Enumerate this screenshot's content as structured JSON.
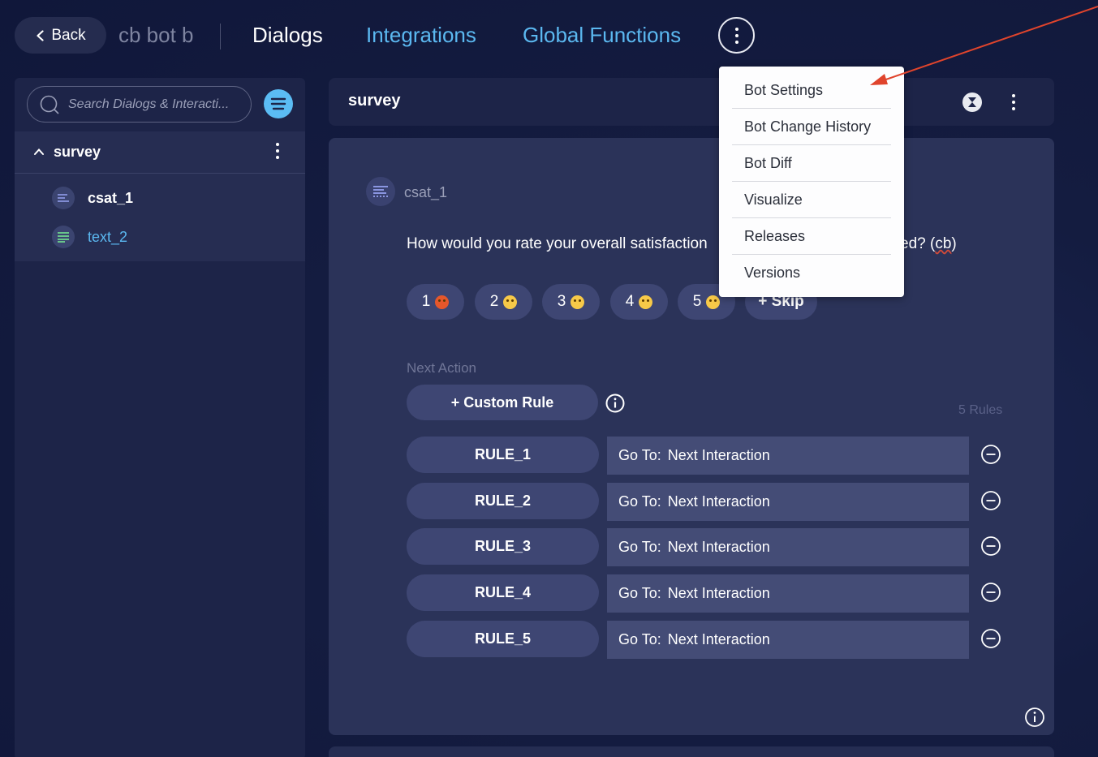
{
  "topbar": {
    "back_label": "Back",
    "bot_name": "cb bot b",
    "nav": {
      "dialogs": "Dialogs",
      "integrations": "Integrations",
      "global_functions": "Global Functions"
    }
  },
  "sidebar": {
    "search_placeholder": "Search Dialogs & Interacti...",
    "dialog_title": "survey",
    "items": [
      {
        "label": "csat_1",
        "icon": "list-icon"
      },
      {
        "label": "text_2",
        "icon": "text-icon"
      }
    ]
  },
  "header": {
    "title": "survey"
  },
  "node": {
    "name": "csat_1",
    "question_part1": "How would you rate your overall satisfaction",
    "question_part2_prefix": "ed? (",
    "question_part2_cb": "cb",
    "question_part2_suffix": ")",
    "choices": [
      {
        "label": "1",
        "emoji": "angry-face-icon"
      },
      {
        "label": "2",
        "emoji": "frowning-face-icon"
      },
      {
        "label": "3",
        "emoji": "neutral-face-icon"
      },
      {
        "label": "4",
        "emoji": "slightly-smiling-face-icon"
      },
      {
        "label": "5",
        "emoji": "grinning-face-icon"
      }
    ],
    "skip_label": "+ Skip"
  },
  "next_action": {
    "label": "Next Action",
    "custom_rule_label": "+ Custom Rule",
    "rules_count": "5 Rules",
    "rules": [
      {
        "name": "RULE_1",
        "go_to_label": "Go To:",
        "target": "Next Interaction"
      },
      {
        "name": "RULE_2",
        "go_to_label": "Go To:",
        "target": "Next Interaction"
      },
      {
        "name": "RULE_3",
        "go_to_label": "Go To:",
        "target": "Next Interaction"
      },
      {
        "name": "RULE_4",
        "go_to_label": "Go To:",
        "target": "Next Interaction"
      },
      {
        "name": "RULE_5",
        "go_to_label": "Go To:",
        "target": "Next Interaction"
      }
    ]
  },
  "dropdown": {
    "items": [
      "Bot Settings",
      "Bot Change History",
      "Bot Diff",
      "Visualize",
      "Releases",
      "Versions"
    ]
  },
  "colors": {
    "accent_blue": "#5bb8f0",
    "panel": "#1d2448",
    "card": "#2b3359",
    "annotation_arrow": "#e0442c"
  }
}
